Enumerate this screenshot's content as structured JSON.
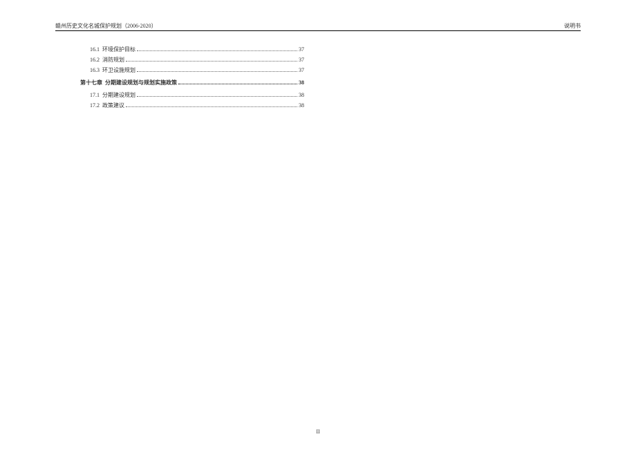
{
  "header_left": "赣州历史文化名城保护规划（2006-2020）",
  "header_right": "说明书",
  "toc": {
    "entries": [
      {
        "num": "16.1",
        "text": "环境保护目标",
        "page": "37",
        "type": "sub"
      },
      {
        "num": "16.2",
        "text": "消防规划",
        "page": "37",
        "type": "sub"
      },
      {
        "num": "16.3",
        "text": "环卫设施规划",
        "page": "37",
        "type": "sub"
      },
      {
        "num": "第十七章",
        "text": "分期建设规划与规划实施政策",
        "page": "38",
        "type": "chapter"
      },
      {
        "num": "17.1",
        "text": "分期建设规划",
        "page": "38",
        "type": "sub"
      },
      {
        "num": "17.2",
        "text": "政策建议",
        "page": "38",
        "type": "sub"
      }
    ]
  },
  "page_number": "II"
}
